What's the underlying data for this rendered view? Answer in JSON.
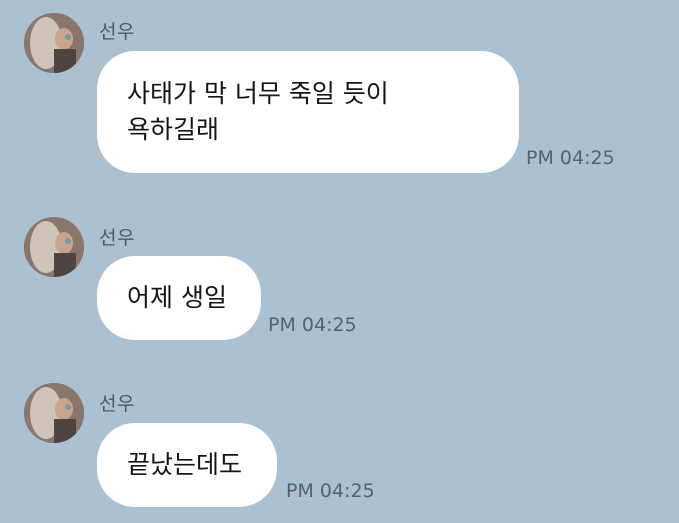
{
  "colors": {
    "background": "#abc1d1",
    "bubble": "#ffffff",
    "sender_text": "#4d5761",
    "time_text": "#56616c"
  },
  "messages": [
    {
      "sender": "선우",
      "avatar_icon": "profile-photo-avatar",
      "lines": [
        "사태가 막 너무 죽일 듯이",
        "욕하길래"
      ],
      "time": "PM 04:25"
    },
    {
      "sender": "선우",
      "avatar_icon": "profile-photo-avatar",
      "lines": [
        "어제 생일"
      ],
      "time": "PM 04:25"
    },
    {
      "sender": "선우",
      "avatar_icon": "profile-photo-avatar",
      "lines": [
        "끝났는데도"
      ],
      "time": "PM 04:25"
    }
  ]
}
